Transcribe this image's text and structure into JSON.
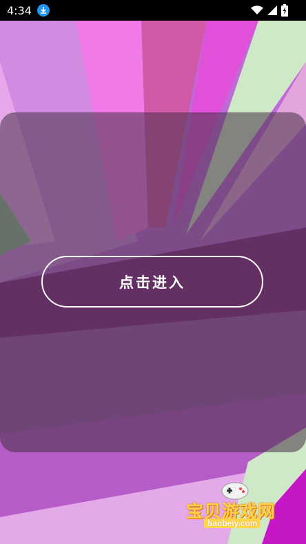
{
  "status_bar": {
    "time": "4:34",
    "icons": [
      "download-icon",
      "wifi-icon",
      "signal-icon",
      "battery-icon"
    ]
  },
  "main": {
    "enter_button_label": "点击进入"
  },
  "watermark": {
    "brand": "宝贝游戏网",
    "url": "baobeiy.com"
  },
  "colors": {
    "button_border": "#ffffff",
    "panel_overlay": "#463246"
  }
}
